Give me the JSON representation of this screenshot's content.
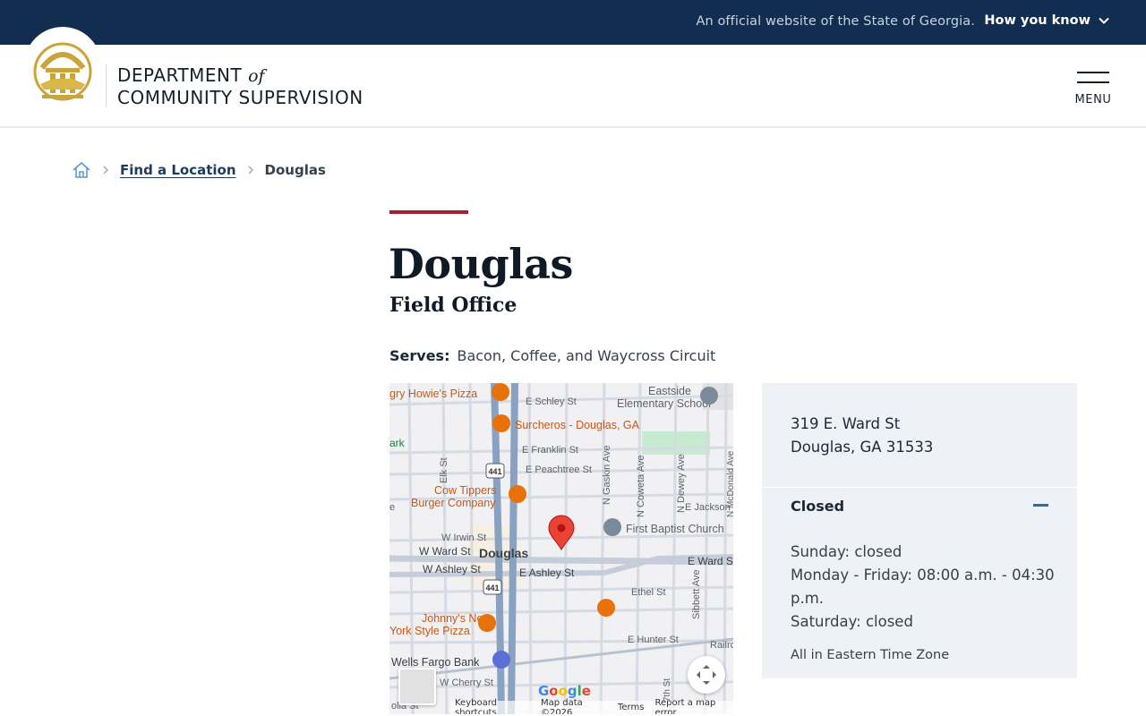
{
  "banner": {
    "official_text": "An official website of the State of Georgia.",
    "how_you_know": "How you know"
  },
  "header": {
    "brand_line1": "DEPARTMENT",
    "brand_of": "of",
    "brand_line2": "COMMUNITY SUPERVISION",
    "menu_label": "MENU"
  },
  "breadcrumb": {
    "link": "Find a Location",
    "current": "Douglas"
  },
  "page": {
    "title": "Douglas",
    "subtitle": "Field Office",
    "serves_label": "Serves:",
    "serves_value": "Bacon, Coffee, and Waycross Circuit"
  },
  "map": {
    "places": {
      "howies": "gry Howie's Pizza",
      "surcheros": "Surcheros - Douglas, GA",
      "school_1": "Eastside",
      "school_2": "Elementary School",
      "park": "ark",
      "cow_1": "Cow Tippers",
      "cow_2": "Burger Company",
      "baptist": "First Baptist Church",
      "douglas": "Douglas",
      "johnnys_1": "Johnny's New",
      "johnnys_2": "York Style Pizza",
      "wells": "Wells Fargo Bank"
    },
    "streets": {
      "schley": "E Schley St",
      "franklin": "E Franklin St",
      "peachtree": "E Peachtree St",
      "elk": "Elk St",
      "irwin": "W Irwin St",
      "w_ward": "W Ward St",
      "w_ashley": "W Ashley St",
      "e_ashley": "E Ashley St",
      "e_ward": "E Ward S",
      "jackson": "E Jackson",
      "gaskin": "N Gaskin Ave",
      "coweta": "N Coweta Ave",
      "dewey": "N Dewey Ave",
      "mcdonald": "N McDonald Ave",
      "ethel": "Ethel St",
      "sibbett": "Sibbett Ave",
      "hunter": "E Hunter St",
      "railroad": "Railro",
      "cherry": "W Cherry St",
      "seventh": "7th St",
      "lia": "olia St",
      "e_left": "e",
      "hwy": "441"
    },
    "google_logo": "Google",
    "footer": {
      "shortcuts": "Keyboard shortcuts",
      "data": "Map data ©2026",
      "terms": "Terms",
      "report": "Report a map error"
    }
  },
  "location": {
    "street": "319 E. Ward St",
    "city_state_zip": "Douglas, GA 31533",
    "status": "Closed",
    "hours": {
      "sunday": "Sunday: closed",
      "weekday": "Monday - Friday: 08:00 a.m. - 04:30 p.m.",
      "saturday": "Saturday: closed"
    },
    "timezone": "All in Eastern Time Zone"
  },
  "colors": {
    "banner_bg": "#112e51",
    "accent_red": "#a4212e",
    "seal_gold": "#c9a43a",
    "card_bg": "#eef2f6",
    "link_blue": "#1d3b5c",
    "map_pin": "#ea4335",
    "poi_orange": "#e8710a"
  },
  "icons": {
    "home": "home-icon",
    "chevron": "chevron-right-icon",
    "seal": "georgia-seal-icon",
    "collapse": "minus-icon"
  }
}
